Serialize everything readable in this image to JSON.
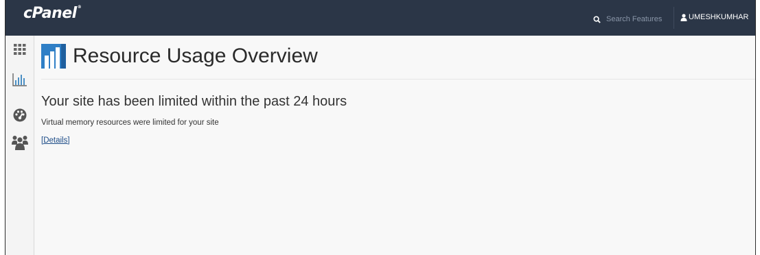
{
  "app": {
    "logo_text": "cPanel",
    "logo_mark": "®"
  },
  "header": {
    "search_placeholder": "Search Features",
    "search_value": "",
    "username": "UMESHKUMHAR",
    "user_caret": "▼"
  },
  "sidebar": {
    "items": [
      {
        "icon": "grid-icon",
        "label": "Home"
      },
      {
        "icon": "bar-chart-icon",
        "label": "Statistics"
      },
      {
        "icon": "dashboard-icon",
        "label": "Dashboard"
      },
      {
        "icon": "users-icon",
        "label": "User Manager"
      }
    ]
  },
  "page": {
    "icon": "resource-usage-icon",
    "title": "Resource Usage Overview"
  },
  "notice": {
    "title": "Your site has been limited within the past 24 hours",
    "text": "Virtual memory resources were limited for your site",
    "details_link": "[Details]"
  },
  "colors": {
    "topbar": "#2b3647",
    "accent_blue": "#2f7fc6",
    "link": "#1a4a86"
  }
}
